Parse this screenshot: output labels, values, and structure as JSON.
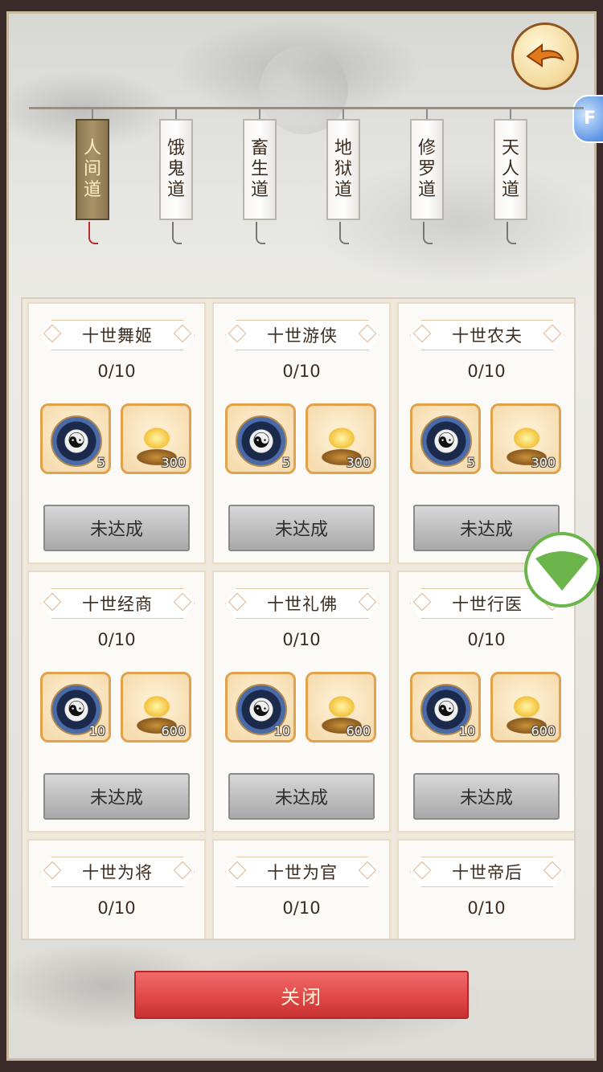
{
  "tabs": [
    {
      "label": "人\n间\n道",
      "chars": [
        "人",
        "间",
        "道"
      ],
      "active": true
    },
    {
      "label": "饿\n鬼\n道",
      "chars": [
        "饿",
        "鬼",
        "道"
      ],
      "active": false
    },
    {
      "label": "畜\n生\n道",
      "chars": [
        "畜",
        "生",
        "道"
      ],
      "active": false
    },
    {
      "label": "地\n狱\n道",
      "chars": [
        "地",
        "狱",
        "道"
      ],
      "active": false
    },
    {
      "label": "修\n罗\n道",
      "chars": [
        "修",
        "罗",
        "道"
      ],
      "active": false
    },
    {
      "label": "天\n人\n道",
      "chars": [
        "天",
        "人",
        "道"
      ],
      "active": false
    }
  ],
  "side_tab": {
    "text": "F"
  },
  "cards": [
    {
      "title": "十世舞姬",
      "progress": "0/10",
      "reward1_qty": "5",
      "reward2_qty": "300",
      "status": "未达成"
    },
    {
      "title": "十世游侠",
      "progress": "0/10",
      "reward1_qty": "5",
      "reward2_qty": "300",
      "status": "未达成"
    },
    {
      "title": "十世农夫",
      "progress": "0/10",
      "reward1_qty": "5",
      "reward2_qty": "300",
      "status": "未达成"
    },
    {
      "title": "十世经商",
      "progress": "0/10",
      "reward1_qty": "10",
      "reward2_qty": "600",
      "status": "未达成"
    },
    {
      "title": "十世礼佛",
      "progress": "0/10",
      "reward1_qty": "10",
      "reward2_qty": "600",
      "status": "未达成"
    },
    {
      "title": "十世行医",
      "progress": "0/10",
      "reward1_qty": "10",
      "reward2_qty": "600",
      "status": "未达成"
    },
    {
      "title": "十世为将",
      "progress": "0/10"
    },
    {
      "title": "十世为官",
      "progress": "0/10"
    },
    {
      "title": "十世帝后",
      "progress": "0/10"
    }
  ],
  "icons": {
    "reward1": "bagua-compass-icon",
    "reward2": "gold-ingot-icon",
    "back": "back-arrow-icon",
    "wifi": "wifi-icon"
  },
  "close_button": {
    "label": "关闭"
  },
  "colors": {
    "active_tab": "#8b7650",
    "reward_border": "#e0a24a",
    "close_button": "#e24848",
    "wifi": "#6bb54a"
  }
}
